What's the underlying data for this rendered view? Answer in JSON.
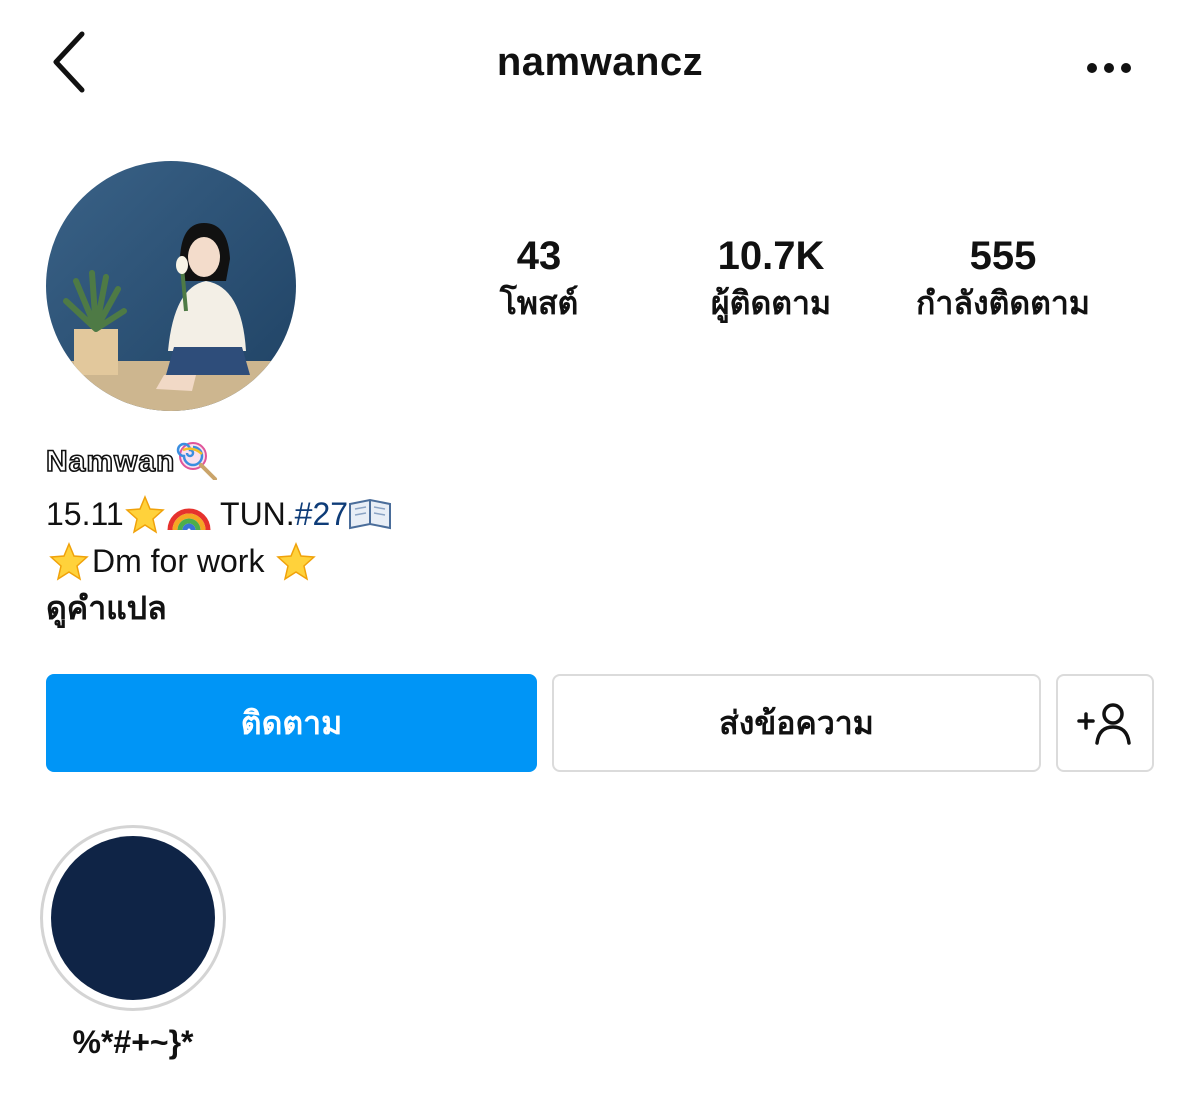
{
  "header": {
    "username": "namwancz",
    "back_icon": "chevron-left-icon",
    "more_icon": "more-horizontal-icon"
  },
  "profile": {
    "display_name": "Namwan",
    "display_name_emoji": "lollipop-icon"
  },
  "stats": [
    {
      "value": "43",
      "label": "โพสต์"
    },
    {
      "value": "10.7K",
      "label": "ผู้ติดตาม"
    },
    {
      "value": "555",
      "label": "กำลังติดตาม"
    }
  ],
  "bio": {
    "line1_date": "15.11",
    "line1_text": "TUN.",
    "line1_hashtag": "#27",
    "line2_text": "Dm for work",
    "translate_label": "ดูคำแปล"
  },
  "actions": {
    "follow_label": "ติดตาม",
    "message_label": "ส่งข้อความ",
    "suggest_icon": "add-person-icon"
  },
  "highlights": [
    {
      "title": "%*#+~}*"
    }
  ],
  "colors": {
    "follow_button": "#0095f6",
    "hashtag": "#0e3c78",
    "highlight_cover": "#0f2446",
    "avatar_background": "#2f5577"
  }
}
